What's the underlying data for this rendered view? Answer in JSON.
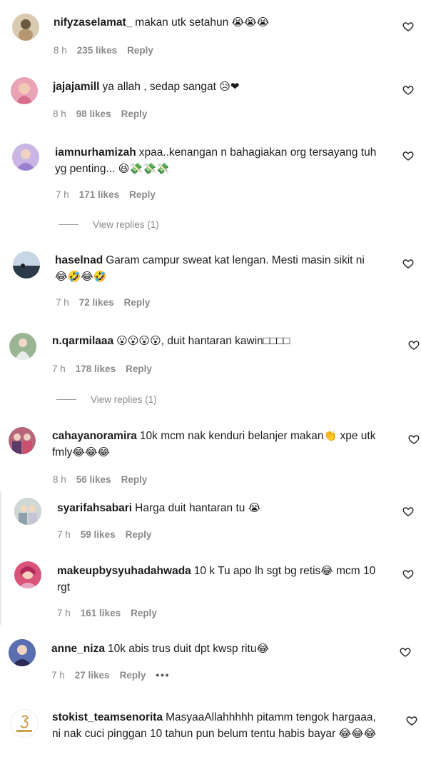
{
  "comments": [
    {
      "user": "nifyzaselamat_",
      "text": "makan utk setahun",
      "emoji": "😭😭😭",
      "time": "8 h",
      "likes": "235 likes",
      "reply": "Reply"
    },
    {
      "user": "jajajamill",
      "text": "ya allah , sedap sangat",
      "emoji": "😥❤",
      "time": "8 h",
      "likes": "98 likes",
      "reply": "Reply"
    },
    {
      "user": "iamnurhamizah",
      "text": "xpaa..kenangan n bahagiakan org tersayang tuh yg penting...",
      "emoji": "😆💸💸💸",
      "time": "7 h",
      "likes": "171 likes",
      "reply": "Reply",
      "view_replies": "View replies (1)"
    },
    {
      "user": "haselnad",
      "text": "Garam campur sweat kat lengan. Mesti masin sikit ni",
      "emoji": "😂🤣😂🤣",
      "time": "7 h",
      "likes": "72 likes",
      "reply": "Reply"
    },
    {
      "user": "n.qarmilaaa",
      "text_pre": "😮😮😮😮",
      "text": ", duit hantaran kawin□□□□",
      "time": "7 h",
      "likes": "178 likes",
      "reply": "Reply",
      "view_replies": "View replies (1)"
    },
    {
      "user": "cahayanoramira",
      "text": "10k mcm nak kenduri belanjer makan",
      "emoji_mid": "👏",
      "text2": " xpe utk fmly",
      "emoji": "😂😂😂",
      "time": "8 h",
      "likes": "56 likes",
      "reply": "Reply"
    },
    {
      "user": "syarifahsabari",
      "text": "Harga duit hantaran tu",
      "emoji": "😭",
      "time": "7 h",
      "likes": "59 likes",
      "reply": "Reply"
    },
    {
      "user": "makeupbysyuhadahwada",
      "text": "10 k Tu apo lh sgt bg retis",
      "emoji_mid": "😂",
      "text2": " mcm 10 rgt",
      "time": "7 h",
      "likes": "161 likes",
      "reply": "Reply"
    },
    {
      "user": "anne_niza",
      "text": "10k abis trus duit dpt kwsp ritu",
      "emoji": "😂",
      "time": "7 h",
      "likes": "27 likes",
      "reply": "Reply",
      "more": "•••"
    },
    {
      "user": "stokist_teamsenorita",
      "text": "MasyaaAllahhhhh pitamm tengok hargaaa, ni nak cuci pinggan 10 tahun pun belum tentu habis bayar",
      "emoji": "😂😂😂",
      "time": "",
      "likes": "",
      "reply": ""
    }
  ],
  "avatar_colors": [
    "#d8cbb0",
    "#e8a3b5",
    "#c9b6e4",
    "#8a9bb0",
    "#9bb592",
    "#b7667a",
    "#9aa5a0",
    "#d9547a",
    "#3b3f7a",
    "#f2e2b8"
  ],
  "icons": {
    "like": "heart-outline-icon",
    "more": "more-dots-icon"
  }
}
